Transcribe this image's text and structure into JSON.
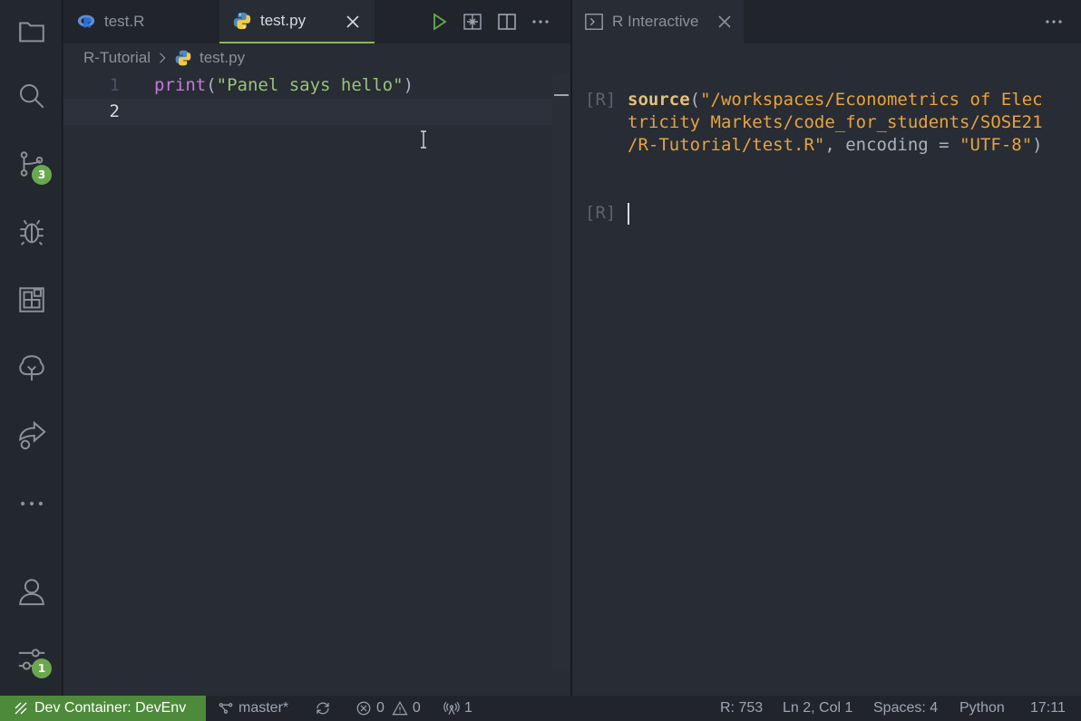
{
  "activity_bar": {
    "items": [
      {
        "icon": "files-icon"
      },
      {
        "icon": "search-icon"
      },
      {
        "icon": "source-control-icon",
        "badge": "3"
      },
      {
        "icon": "debug-icon"
      },
      {
        "icon": "extensions-icon"
      },
      {
        "icon": "tree-icon"
      },
      {
        "icon": "remote-share-icon"
      },
      {
        "icon": "more-icon"
      }
    ],
    "bottom": [
      {
        "icon": "account-icon"
      },
      {
        "icon": "settings-icon",
        "badge": "1"
      }
    ]
  },
  "editor": {
    "tabs": [
      {
        "label": "test.R",
        "icon": "r-file-icon",
        "active": false
      },
      {
        "label": "test.py",
        "icon": "python-file-icon",
        "active": true
      }
    ],
    "breadcrumb": {
      "folder": "R-Tutorial",
      "file": "test.py"
    },
    "lines": [
      {
        "num": "1",
        "fn": "print",
        "open": "(",
        "str": "\"Panel says hello\"",
        "close": ")"
      },
      {
        "num": "2"
      }
    ]
  },
  "right_panel": {
    "tab_label": "R Interactive",
    "prompt": "[R]",
    "command": {
      "line1_kw": "source",
      "line1_punc": "(",
      "line1_str": "\"/workspaces/Econometrics of Elec",
      "line2_str": "tricity Markets/code_for_students/SOSE21",
      "line3_str": "/R-Tutorial/test.R\"",
      "line3_rest": ", encoding = ",
      "line3_str2": "\"UTF-8\"",
      "line3_close": ")"
    },
    "prompt2": "[R]"
  },
  "status_bar": {
    "remote": "Dev Container: DevEnv",
    "branch": "master*",
    "errors": "0",
    "warnings": "0",
    "ports": "1",
    "r_pid": "R: 753",
    "position": "Ln 2, Col 1",
    "spaces": "Spaces: 4",
    "language": "Python",
    "time": "17:11"
  },
  "colors": {
    "accent_green": "#4d8a3a",
    "badge_green": "#6aa84f",
    "string_orange": "#e8a33d"
  }
}
